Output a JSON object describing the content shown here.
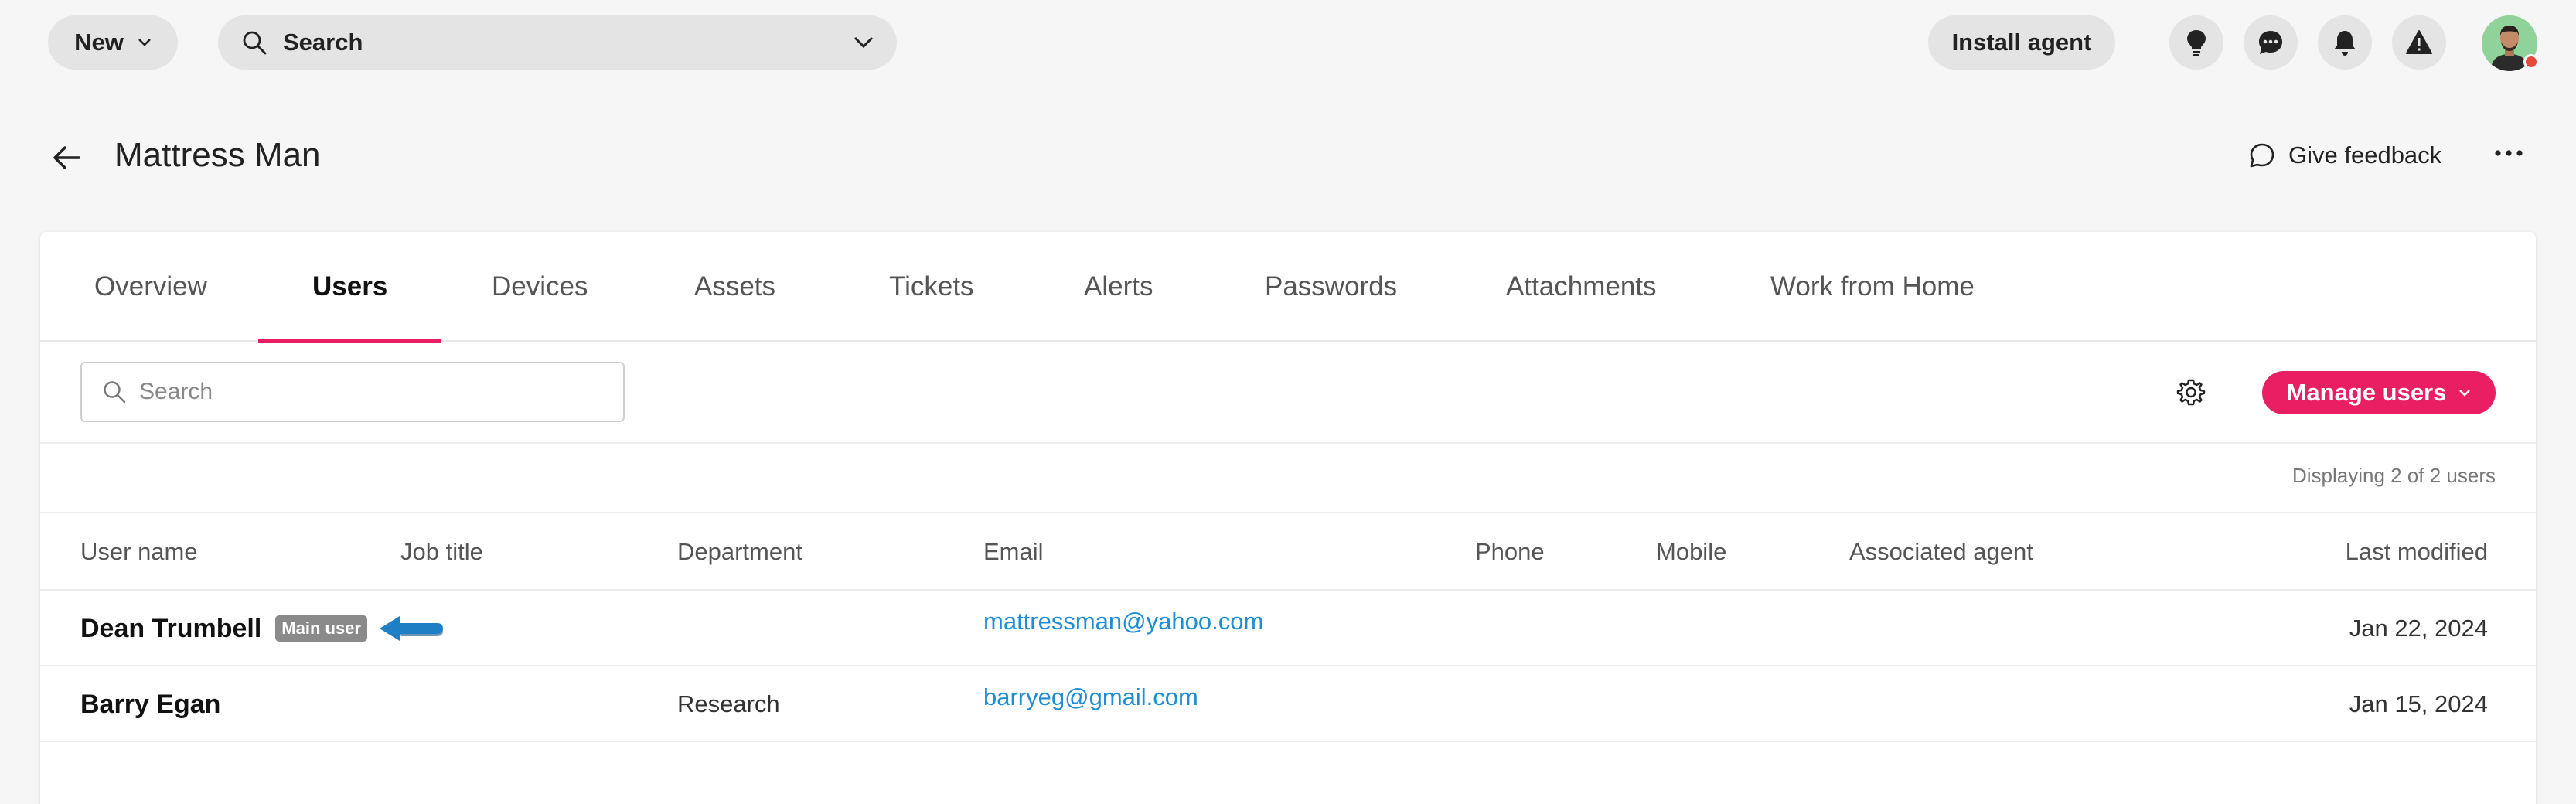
{
  "topbar": {
    "new_label": "New",
    "search_label": "Search",
    "install_label": "Install agent",
    "icons": [
      "lightbulb-icon",
      "chat-icon",
      "bell-icon",
      "alert-icon"
    ]
  },
  "header": {
    "title": "Mattress Man",
    "feedback_label": "Give feedback"
  },
  "tabs": [
    {
      "label": "Overview"
    },
    {
      "label": "Users",
      "active": true
    },
    {
      "label": "Devices"
    },
    {
      "label": "Assets"
    },
    {
      "label": "Tickets"
    },
    {
      "label": "Alerts"
    },
    {
      "label": "Passwords"
    },
    {
      "label": "Attachments"
    },
    {
      "label": "Work from Home"
    }
  ],
  "toolbar": {
    "search_placeholder": "Search",
    "manage_label": "Manage users"
  },
  "display_count": "Displaying 2 of 2 users",
  "table": {
    "columns": [
      "User name",
      "Job title",
      "Department",
      "Email",
      "Phone",
      "Mobile",
      "Associated agent",
      "Last modified"
    ],
    "rows": [
      {
        "name": "Dean Trumbell",
        "badge": "Main user",
        "job": "",
        "department": "",
        "email": "mattressman@yahoo.com",
        "phone": "",
        "mobile": "",
        "agent": "",
        "modified": "Jan 22, 2024"
      },
      {
        "name": "Barry Egan",
        "badge": "",
        "job": "",
        "department": "Research",
        "email": "barryeg@gmail.com",
        "phone": "",
        "mobile": "",
        "agent": "",
        "modified": "Jan 15, 2024"
      }
    ]
  },
  "colors": {
    "accent": "#e91e63",
    "link": "#1d8ed6",
    "annotation_arrow": "#1f7fc4"
  }
}
